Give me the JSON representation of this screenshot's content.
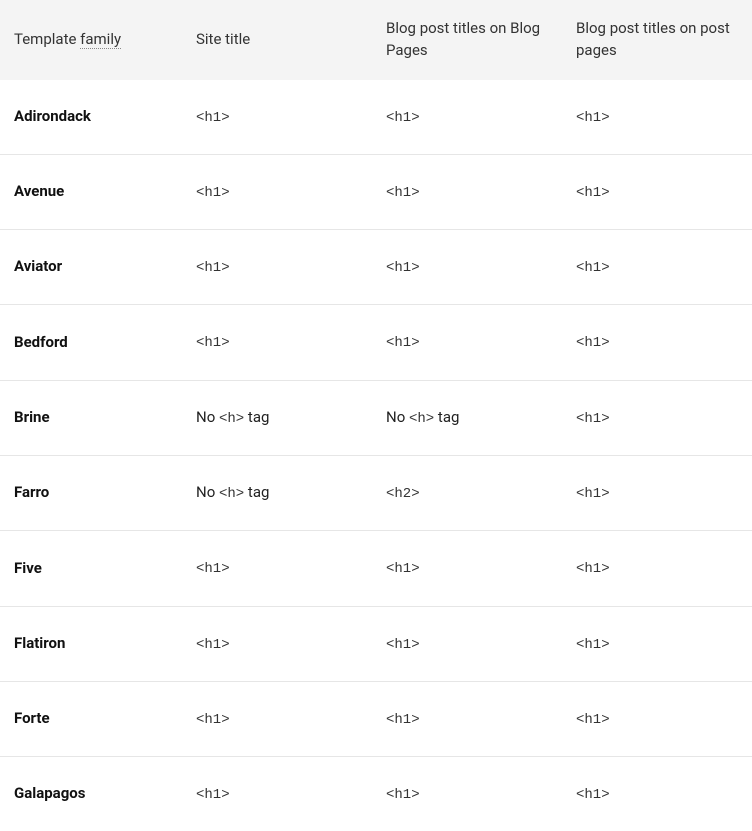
{
  "headers": {
    "col1_prefix": "Template ",
    "col1_dotted": "family",
    "col2": "Site title",
    "col3": "Blog post titles on Blog Pages",
    "col4": "Blog post titles on post pages"
  },
  "rows": [
    {
      "name": "Adirondack",
      "c2": {
        "pre": "",
        "code": "<h1>",
        "post": ""
      },
      "c3": {
        "pre": "",
        "code": "<h1>",
        "post": ""
      },
      "c4": {
        "pre": "",
        "code": "<h1>",
        "post": ""
      }
    },
    {
      "name": "Avenue",
      "c2": {
        "pre": "",
        "code": "<h1>",
        "post": ""
      },
      "c3": {
        "pre": "",
        "code": "<h1>",
        "post": ""
      },
      "c4": {
        "pre": "",
        "code": "<h1>",
        "post": ""
      }
    },
    {
      "name": "Aviator",
      "c2": {
        "pre": "",
        "code": "<h1>",
        "post": ""
      },
      "c3": {
        "pre": "",
        "code": "<h1>",
        "post": ""
      },
      "c4": {
        "pre": "",
        "code": "<h1>",
        "post": ""
      }
    },
    {
      "name": "Bedford",
      "c2": {
        "pre": "",
        "code": "<h1>",
        "post": ""
      },
      "c3": {
        "pre": "",
        "code": "<h1>",
        "post": ""
      },
      "c4": {
        "pre": "",
        "code": "<h1>",
        "post": ""
      }
    },
    {
      "name": "Brine",
      "c2": {
        "pre": "No ",
        "code": "<h>",
        "post": " tag"
      },
      "c3": {
        "pre": "No ",
        "code": "<h>",
        "post": " tag"
      },
      "c4": {
        "pre": "",
        "code": "<h1>",
        "post": ""
      }
    },
    {
      "name": "Farro",
      "c2": {
        "pre": "No ",
        "code": "<h>",
        "post": " tag"
      },
      "c3": {
        "pre": "",
        "code": "<h2>",
        "post": ""
      },
      "c4": {
        "pre": "",
        "code": "<h1>",
        "post": ""
      }
    },
    {
      "name": "Five",
      "c2": {
        "pre": "",
        "code": "<h1>",
        "post": ""
      },
      "c3": {
        "pre": "",
        "code": "<h1>",
        "post": ""
      },
      "c4": {
        "pre": "",
        "code": "<h1>",
        "post": ""
      }
    },
    {
      "name": "Flatiron",
      "c2": {
        "pre": "",
        "code": "<h1>",
        "post": ""
      },
      "c3": {
        "pre": "",
        "code": "<h1>",
        "post": ""
      },
      "c4": {
        "pre": "",
        "code": "<h1>",
        "post": ""
      }
    },
    {
      "name": "Forte",
      "c2": {
        "pre": "",
        "code": "<h1>",
        "post": ""
      },
      "c3": {
        "pre": "",
        "code": "<h1>",
        "post": ""
      },
      "c4": {
        "pre": "",
        "code": "<h1>",
        "post": ""
      }
    },
    {
      "name": "Galapagos",
      "c2": {
        "pre": "",
        "code": "<h1>",
        "post": ""
      },
      "c3": {
        "pre": "",
        "code": "<h1>",
        "post": ""
      },
      "c4": {
        "pre": "",
        "code": "<h1>",
        "post": ""
      }
    }
  ]
}
